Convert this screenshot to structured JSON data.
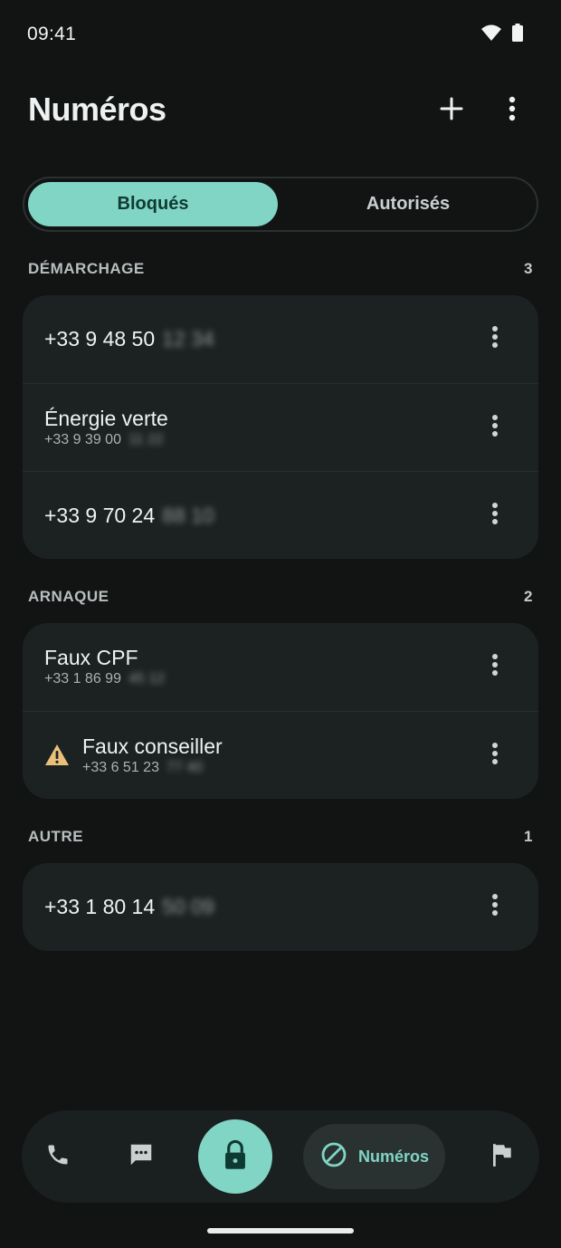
{
  "status_bar": {
    "time": "09:41"
  },
  "header": {
    "title": "Numéros"
  },
  "tabs": [
    {
      "label": "Bloqués",
      "selected": true
    },
    {
      "label": "Autorisés",
      "selected": false
    }
  ],
  "sections": [
    {
      "title": "DÉMARCHAGE",
      "count": "3",
      "items": [
        {
          "primary": "+33 9 48 50",
          "hidden": "12 34"
        },
        {
          "primary": "Énergie verte",
          "secondary": "+33 9 39 00",
          "hidden": "11 22"
        },
        {
          "primary": "+33 9 70 24",
          "hidden": "88 10"
        }
      ]
    },
    {
      "title": "ARNAQUE",
      "count": "2",
      "items": [
        {
          "primary": "Faux CPF",
          "secondary": "+33 1 86 99",
          "hidden": "45 12"
        },
        {
          "primary": "Faux conseiller",
          "secondary": "+33 6 51 23",
          "hidden": "77 40",
          "icon": "warning-icon"
        }
      ]
    },
    {
      "title": "AUTRE",
      "count": "1",
      "items": [
        {
          "primary": "+33 1 80 14",
          "hidden": "50 09"
        }
      ]
    }
  ],
  "bottom_nav": {
    "items": [
      {
        "icon": "phone-icon"
      },
      {
        "icon": "message-icon"
      },
      {
        "icon": "lock-icon"
      },
      {
        "icon": "block-icon",
        "label": "Numéros",
        "selected": true
      },
      {
        "icon": "flag-icon"
      }
    ]
  },
  "colors": {
    "background": "#121414",
    "surface": "#1c2222",
    "accent": "#80d5c5",
    "warning": "#e8c07a"
  }
}
